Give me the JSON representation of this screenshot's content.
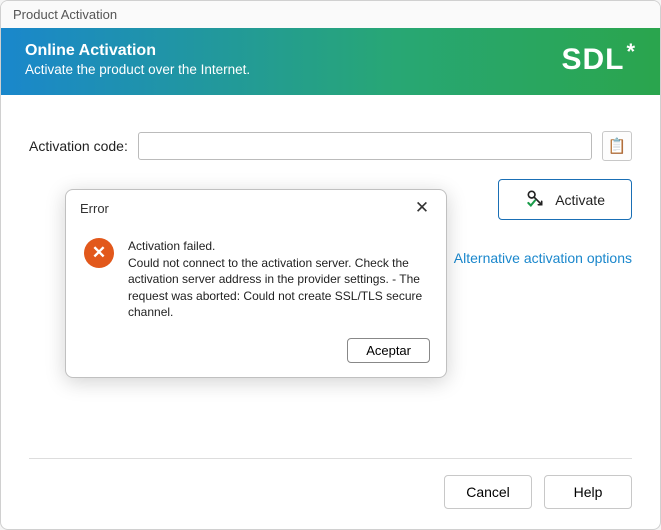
{
  "window": {
    "title": "Product Activation"
  },
  "banner": {
    "title": "Online Activation",
    "subtitle": "Activate the product over the Internet.",
    "logo_text": "SDL",
    "logo_star": "*"
  },
  "form": {
    "code_label": "Activation code:",
    "code_value": "",
    "activate_label": "Activate",
    "alt_link": "Alternative activation options"
  },
  "footer": {
    "cancel": "Cancel",
    "help": "Help"
  },
  "dialog": {
    "title": "Error",
    "headline": "Activation failed.",
    "body": "Could not connect to the activation server. Check the activation server address in the provider settings. - The request was aborted: Could not create SSL/TLS secure channel.",
    "accept": "Aceptar"
  }
}
